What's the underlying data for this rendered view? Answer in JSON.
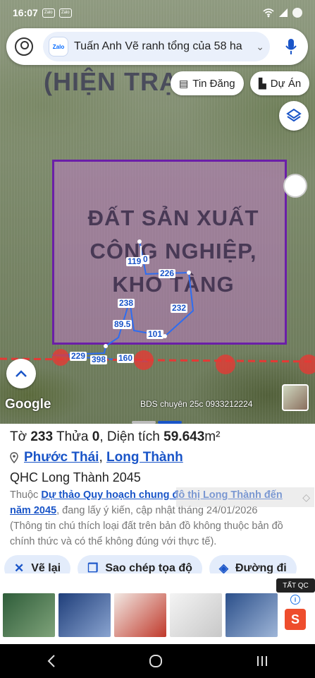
{
  "status": {
    "time": "16:07",
    "app_icon_1": "Zalo",
    "app_icon_2": "Zalo"
  },
  "search": {
    "query": "Tuấn Anh Vẽ ranh tổng của 58 ha",
    "badge": "Zalo"
  },
  "chips": {
    "news": "Tin Đăng",
    "projects": "Dự Án"
  },
  "map": {
    "heading": "(HIỆN TRẠNG",
    "zone_label": "ĐẤT SẢN XUẤT CÔNG NGHIỆP, KHO TÀNG",
    "dimensions": [
      "119",
      "0",
      "226",
      "238",
      "232",
      "89.5",
      "101",
      "229",
      "398",
      "160"
    ],
    "google": "Google",
    "attribution": "BDS chuyên 25c 0933212224",
    "zone_color": "#6b1fa8"
  },
  "parcel": {
    "to_label": "Tờ",
    "to": "233",
    "thua_label": "Thửa",
    "thua": "0",
    "area_label": "Diện tích",
    "area": "59.643",
    "area_unit": "m²",
    "ward": "Phước Thái",
    "district": "Long Thành",
    "plan": "QHC Long Thành 2045",
    "desc_prefix": "Thuộc",
    "desc_link": "Dự thảo Quy hoạch chung đô thị Long Thành đến năm 2045",
    "desc_middle": ", đang lấy ý kiến, cập nhật tháng 24/01/2026",
    "desc_note": "(Thông tin chú thích loại đất trên bản đồ không thuộc bản đồ chính thức và có thể không đúng với thực tế)."
  },
  "actions": {
    "redraw": "Vẽ lại",
    "copy": "Sao chép tọa độ",
    "directions": "Đường đi"
  },
  "ads": {
    "close_label": "TẤT QC"
  },
  "colors": {
    "accent": "#1a55c8",
    "chip_bg": "#e3ecfb"
  }
}
